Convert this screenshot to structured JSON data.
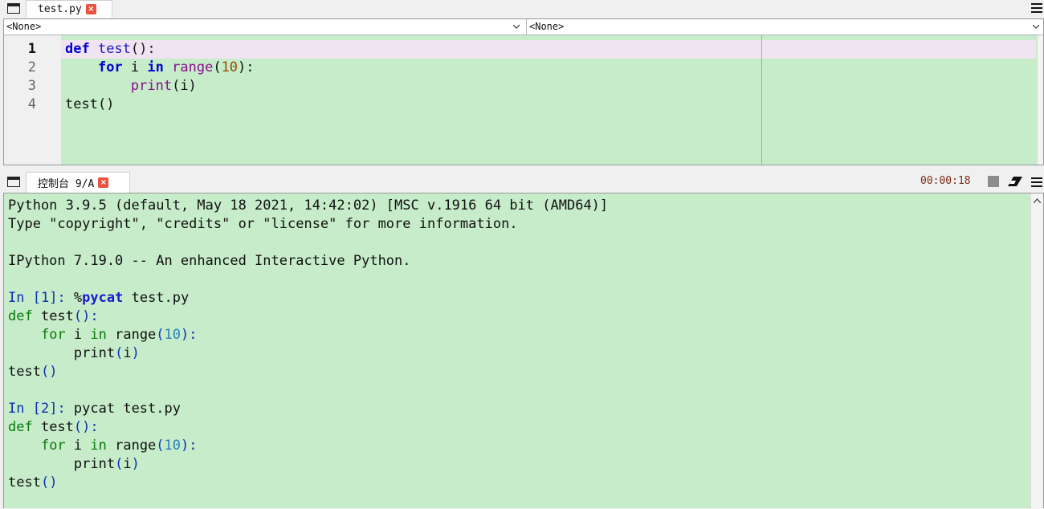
{
  "editor": {
    "tab_label": "test.py",
    "close_glyph": "×",
    "class_combo": "<None>",
    "method_combo": "<None>",
    "line_numbers": [
      "1",
      "2",
      "3",
      "4"
    ],
    "code": [
      [
        {
          "t": "def",
          "c": "kw"
        },
        {
          "t": " "
        },
        {
          "t": "test",
          "c": "fn"
        },
        {
          "t": "():"
        }
      ],
      [
        {
          "t": "    "
        },
        {
          "t": "for",
          "c": "kw"
        },
        {
          "t": " i "
        },
        {
          "t": "in",
          "c": "kw"
        },
        {
          "t": " "
        },
        {
          "t": "range",
          "c": "bi"
        },
        {
          "t": "("
        },
        {
          "t": "10",
          "c": "num"
        },
        {
          "t": "):"
        }
      ],
      [
        {
          "t": "        "
        },
        {
          "t": "print",
          "c": "bi"
        },
        {
          "t": "(i)"
        }
      ],
      [
        {
          "t": "test()"
        }
      ]
    ]
  },
  "console": {
    "tab_label": "控制台 9/A",
    "close_glyph": "×",
    "timer": "00:00:18",
    "lines": [
      [
        {
          "t": "Python 3.9.5 (default, May 18 2021, 14:42:02) [MSC v.1916 64 bit (AMD64)]"
        }
      ],
      [
        {
          "t": "Type \"copyright\", \"credits\" or \"license\" for more information."
        }
      ],
      [],
      [
        {
          "t": "IPython 7.19.0 -- An enhanced Interactive Python."
        }
      ],
      [],
      [
        {
          "t": "In [",
          "c": "p-in"
        },
        {
          "t": "1",
          "c": "p-in"
        },
        {
          "t": "]: ",
          "c": "p-in"
        },
        {
          "t": "%"
        },
        {
          "t": "pycat",
          "c": "p-magic"
        },
        {
          "t": " test.py"
        }
      ],
      [
        {
          "t": "def",
          "c": "c-kw"
        },
        {
          "t": " test"
        },
        {
          "t": "():",
          "c": "c-par"
        }
      ],
      [
        {
          "t": "    "
        },
        {
          "t": "for",
          "c": "c-kw"
        },
        {
          "t": " i "
        },
        {
          "t": "in",
          "c": "c-kw"
        },
        {
          "t": " range"
        },
        {
          "t": "(",
          "c": "c-par"
        },
        {
          "t": "10",
          "c": "c-num"
        },
        {
          "t": "):",
          "c": "c-par"
        }
      ],
      [
        {
          "t": "        print"
        },
        {
          "t": "(",
          "c": "c-par"
        },
        {
          "t": "i"
        },
        {
          "t": ")",
          "c": "c-par"
        }
      ],
      [
        {
          "t": "test"
        },
        {
          "t": "()",
          "c": "c-par"
        }
      ],
      [],
      [
        {
          "t": "In [",
          "c": "p-in"
        },
        {
          "t": "2",
          "c": "p-in"
        },
        {
          "t": "]: ",
          "c": "p-in"
        },
        {
          "t": "pycat test.py"
        }
      ],
      [
        {
          "t": "def",
          "c": "c-kw"
        },
        {
          "t": " test"
        },
        {
          "t": "():",
          "c": "c-par"
        }
      ],
      [
        {
          "t": "    "
        },
        {
          "t": "for",
          "c": "c-kw"
        },
        {
          "t": " i "
        },
        {
          "t": "in",
          "c": "c-kw"
        },
        {
          "t": " range"
        },
        {
          "t": "(",
          "c": "c-par"
        },
        {
          "t": "10",
          "c": "c-num"
        },
        {
          "t": "):",
          "c": "c-par"
        }
      ],
      [
        {
          "t": "        print"
        },
        {
          "t": "(",
          "c": "c-par"
        },
        {
          "t": "i"
        },
        {
          "t": ")",
          "c": "c-par"
        }
      ],
      [
        {
          "t": "test"
        },
        {
          "t": "()",
          "c": "c-par"
        }
      ]
    ]
  },
  "colors": {
    "code_background": "#c6ecca",
    "current_line": "#f1e4f2",
    "close_button": "#e8543f"
  },
  "icons": {
    "pane_toggle": "pane-toggle-icon",
    "options_menu": "hamburger-menu-icon",
    "stop": "stop-icon",
    "clear_console": "eraser-icon",
    "dropdown": "chevron-down-icon"
  }
}
